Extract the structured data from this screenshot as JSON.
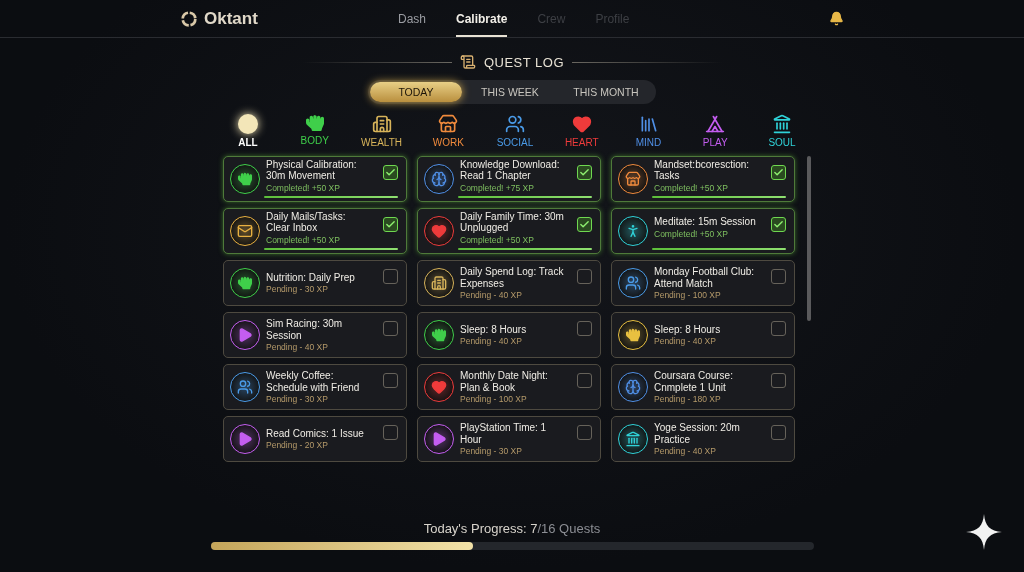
{
  "brand": "Oktant",
  "nav": [
    {
      "label": "Dash",
      "selected": false,
      "disabled": false
    },
    {
      "label": "Calibrate",
      "selected": true,
      "disabled": false
    },
    {
      "label": "Crew",
      "selected": false,
      "disabled": true
    },
    {
      "label": "Profile",
      "selected": false,
      "disabled": true
    }
  ],
  "heading": "QUEST LOG",
  "periods": [
    {
      "label": "TODAY",
      "selected": true
    },
    {
      "label": "THIS WEEK",
      "selected": false
    },
    {
      "label": "THIS MONTH",
      "selected": false
    }
  ],
  "categories": [
    {
      "kind": "all",
      "label": "ALL",
      "color": "#f3e6b8",
      "selected": true
    },
    {
      "kind": "body",
      "label": "BODY",
      "color": "#3fcf4a",
      "selected": false
    },
    {
      "kind": "wealth",
      "label": "WEALTH",
      "color": "#d8b45a",
      "selected": false
    },
    {
      "kind": "work",
      "label": "WORK",
      "color": "#f08a3c",
      "selected": false
    },
    {
      "kind": "social",
      "label": "SOCIAL",
      "color": "#4a9be8",
      "selected": false
    },
    {
      "kind": "heart",
      "label": "HEART",
      "color": "#ef3b3b",
      "selected": false
    },
    {
      "kind": "mind",
      "label": "MIND",
      "color": "#4f8fe6",
      "selected": false
    },
    {
      "kind": "play",
      "label": "PLAY",
      "color": "#c45df0",
      "selected": false
    },
    {
      "kind": "soul",
      "label": "SOUL",
      "color": "#2fd2d8",
      "selected": false
    }
  ],
  "quests": [
    {
      "kind": "fist",
      "color": "#3fcf4a",
      "title": "Physical Calibration: 30m Movement",
      "status": "Completed! +50 XP",
      "checked": true
    },
    {
      "kind": "brain",
      "color": "#4f8fe6",
      "title": "Knowledge Download: Read 1 Chapter",
      "status": "Completed! +75 XP",
      "checked": true
    },
    {
      "kind": "store",
      "color": "#f08a3c",
      "title": "Mandset:bcoresction: Tasks",
      "status": "Completed! +50 XP",
      "checked": true
    },
    {
      "kind": "mail",
      "color": "#e8b040",
      "title": "Daily Mails/Tasks: Clear Inbox",
      "status": "Completed! +50 XP",
      "checked": true
    },
    {
      "kind": "heart",
      "color": "#ef3b3b",
      "title": "Daily Family Time: 30m Unplugged",
      "status": "Completed! +50 XP",
      "checked": true
    },
    {
      "kind": "meditate",
      "color": "#2fd2d8",
      "title": "Meditate: 15m Session",
      "status": "Completed! +50 XP",
      "checked": true
    },
    {
      "kind": "fist",
      "color": "#3fcf4a",
      "title": "Nutrition: Daily Prep",
      "status": "Pending - 30 XP",
      "checked": false
    },
    {
      "kind": "city",
      "color": "#d8b45a",
      "title": "Daily Spend Log: Track Expenses",
      "status": "Pending - 40 XP",
      "checked": false
    },
    {
      "kind": "people",
      "color": "#4a9be8",
      "title": "Monday Football Club: Attend Match",
      "status": "Pending - 100 XP",
      "checked": false
    },
    {
      "kind": "play",
      "color": "#c45df0",
      "title": "Sim Racing: 30m Session",
      "status": "Pending - 40 XP",
      "checked": false
    },
    {
      "kind": "fist",
      "color": "#3fcf4a",
      "title": "Sleep: 8 Hours",
      "status": "Pending - 40 XP",
      "checked": false
    },
    {
      "kind": "fist",
      "color": "#e8c040",
      "title": "Sleep: 8 Hours",
      "status": "Pending - 40 XP",
      "checked": false
    },
    {
      "kind": "people",
      "color": "#4a9be8",
      "title": "Weekly Coffee: Schedule with Friend",
      "status": "Pending - 30 XP",
      "checked": false
    },
    {
      "kind": "heart",
      "color": "#ef3b3b",
      "title": "Monthly Date Night: Plan & Book",
      "status": "Pending - 100 XP",
      "checked": false
    },
    {
      "kind": "brain",
      "color": "#4f8fe6",
      "title": "Coursara Course: Cnmplete 1 Unit",
      "status": "Pending - 180 XP",
      "checked": false
    },
    {
      "kind": "play",
      "color": "#c45df0",
      "title": "Read Comics: 1 Issue",
      "status": "Pending - 20 XP",
      "checked": false
    },
    {
      "kind": "play",
      "color": "#c45df0",
      "title": "PlayStation Time: 1 Hour",
      "status": "Pending - 30 XP",
      "checked": false
    },
    {
      "kind": "landmark",
      "color": "#2fd2d8",
      "title": "Yoge Session: 20m Practice",
      "status": "Pending - 40 XP",
      "checked": false
    }
  ],
  "progress": {
    "label": "Today's Progress: 7",
    "total": "/16 Quests",
    "level": 0.436
  }
}
